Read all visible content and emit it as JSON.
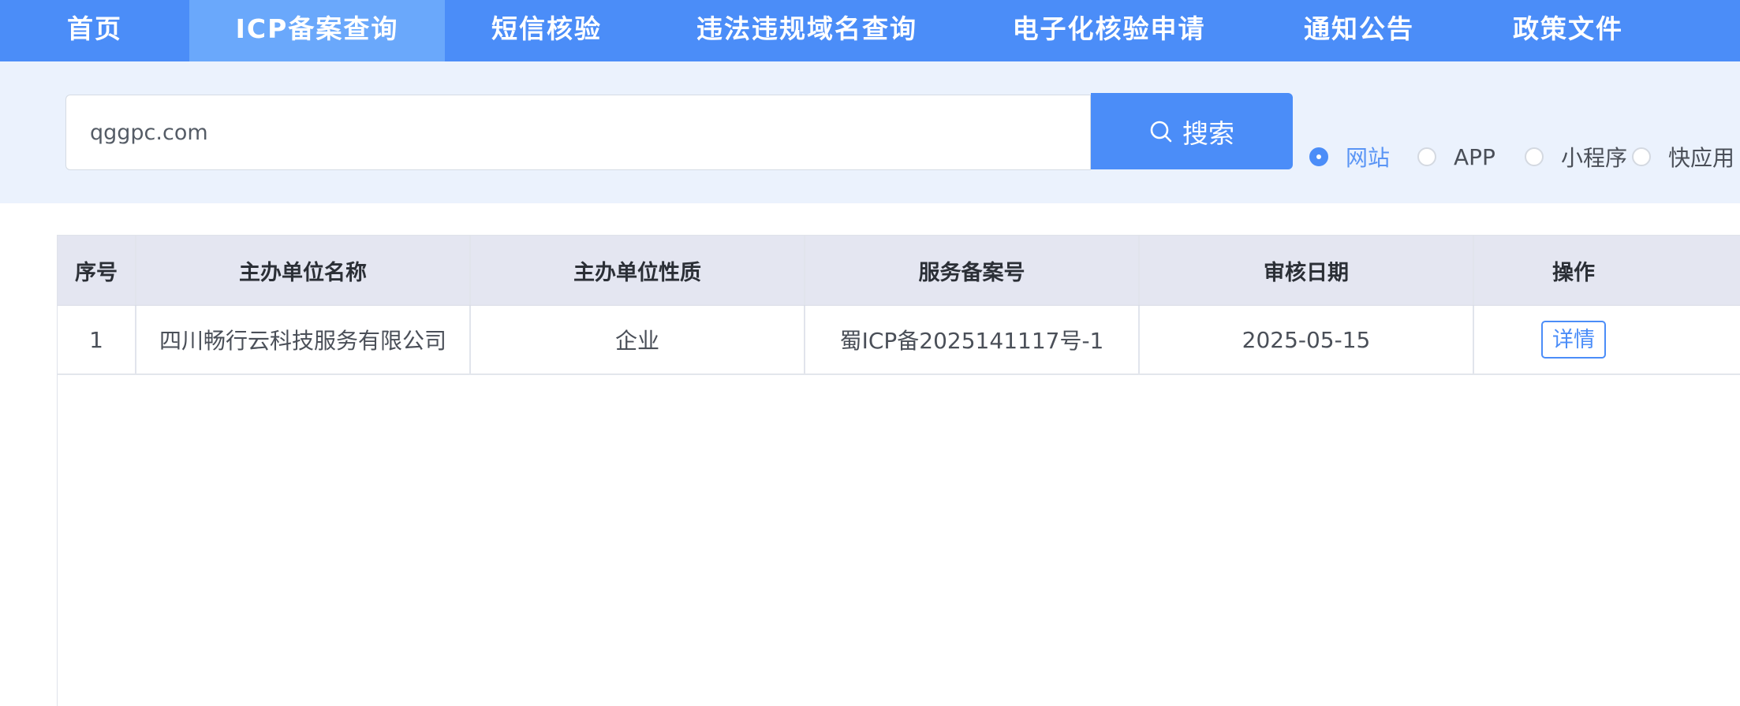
{
  "nav": {
    "items": [
      {
        "label": "首页"
      },
      {
        "label": "ICP备案查询"
      },
      {
        "label": "短信核验"
      },
      {
        "label": "违法违规域名查询"
      },
      {
        "label": "电子化核验申请"
      },
      {
        "label": "通知公告"
      },
      {
        "label": "政策文件"
      }
    ],
    "active_item": "ICP备案查询"
  },
  "search": {
    "value": "qggpc.com",
    "button_label": "搜索",
    "button_icon": "search-icon",
    "options": [
      {
        "label": "网站",
        "checked": true
      },
      {
        "label": "APP",
        "checked": false
      },
      {
        "label": "小程序",
        "checked": false
      },
      {
        "label": "快应用",
        "checked": false
      }
    ]
  },
  "table": {
    "columns": [
      "序号",
      "主办单位名称",
      "主办单位性质",
      "服务备案号",
      "审核日期",
      "操作"
    ],
    "rows": [
      {
        "index": "1",
        "org_name": "四川畅行云科技服务有限公司",
        "org_type": "企业",
        "license_no": "蜀ICP备2025141117号-1",
        "review_date": "2025-05-15",
        "action_label": "详情"
      }
    ]
  },
  "colors": {
    "nav_bg": "#4b8df8",
    "nav_active_bg": "#6aa8fb",
    "search_band_bg": "#ebf2fd",
    "table_header_bg": "#e4e6f1",
    "accent": "#4b8df8"
  }
}
